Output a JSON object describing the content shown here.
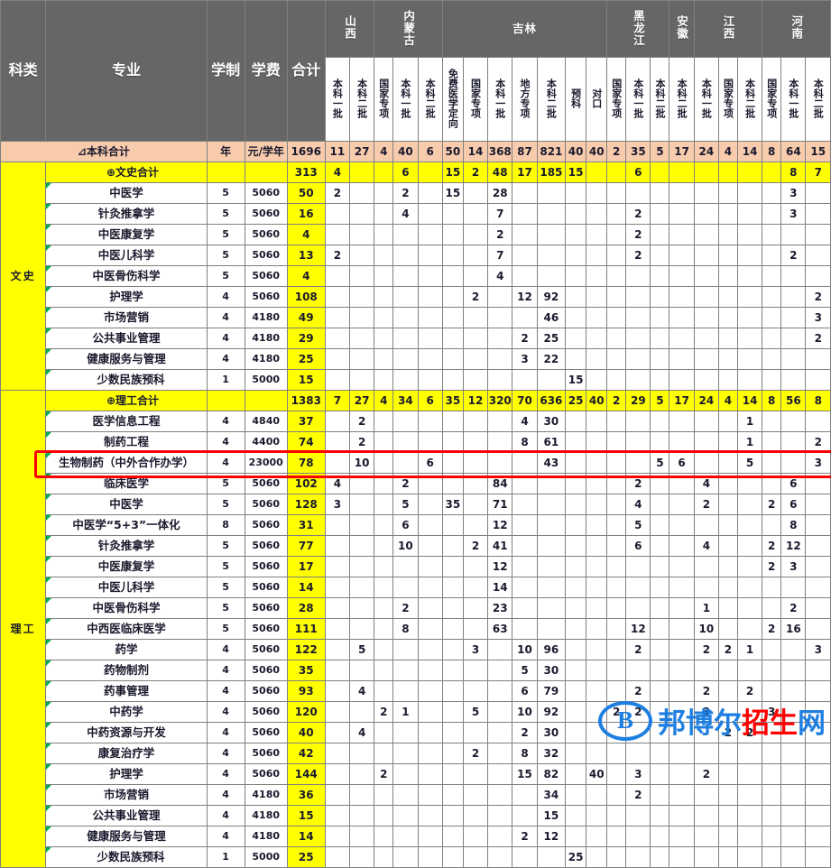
{
  "header": {
    "fixed_columns": [
      {
        "label": "科类",
        "key": "category"
      },
      {
        "label": "专业",
        "key": "major"
      },
      {
        "label": "学制",
        "key": "years"
      },
      {
        "label": "学费",
        "key": "fee"
      },
      {
        "label": "合计",
        "key": "total"
      }
    ],
    "provinces": [
      {
        "name": "山西",
        "cols": [
          "本科一批",
          "本科二批"
        ]
      },
      {
        "name": "内蒙古",
        "cols": [
          "国家专项",
          "本科一批",
          "本科二批"
        ]
      },
      {
        "name": "吉林",
        "cols": [
          "免费医学定向",
          "国家专项",
          "本科一批",
          "地方专项",
          "本科二批",
          "预科",
          "对口"
        ]
      },
      {
        "name": "黑龙江",
        "cols": [
          "国家专项",
          "本科一批",
          "本科二批"
        ]
      },
      {
        "name": "安徽",
        "cols": [
          "本科二批"
        ]
      },
      {
        "name": "江西",
        "cols": [
          "本科一批",
          "国家专项",
          "本科二批"
        ]
      },
      {
        "name": "河南",
        "cols": [
          "国家专项",
          "本科一批",
          "本科二批"
        ]
      }
    ]
  },
  "grand_total": {
    "label": "⊿本科合计",
    "years": "年",
    "fee": "元/学年",
    "total": "1696",
    "values": [
      "11",
      "27",
      "4",
      "40",
      "6",
      "50",
      "14",
      "368",
      "87",
      "821",
      "40",
      "40",
      "2",
      "35",
      "5",
      "17",
      "24",
      "4",
      "14",
      "8",
      "64",
      "15"
    ]
  },
  "sections": [
    {
      "category": "文史",
      "group": {
        "label": "⊕文史合计",
        "years": "",
        "fee": "",
        "total": "313",
        "values": [
          "4",
          "",
          "",
          "6",
          "",
          "15",
          "2",
          "48",
          "17",
          "185",
          "15",
          "",
          "",
          "6",
          "",
          "",
          "",
          "",
          "",
          "",
          "8",
          "7"
        ]
      },
      "rows": [
        {
          "major": "中医学",
          "years": "5",
          "fee": "5060",
          "total": "50",
          "values": [
            "2",
            "",
            "",
            "2",
            "",
            "15",
            "",
            "28",
            "",
            "",
            "",
            "",
            "",
            "",
            "",
            "",
            "",
            "",
            "",
            "",
            "3",
            ""
          ]
        },
        {
          "major": "针灸推拿学",
          "years": "5",
          "fee": "5060",
          "total": "16",
          "values": [
            "",
            "",
            "",
            "4",
            "",
            "",
            "",
            "7",
            "",
            "",
            "",
            "",
            "",
            "2",
            "",
            "",
            "",
            "",
            "",
            "",
            "3",
            ""
          ]
        },
        {
          "major": "中医康复学",
          "years": "5",
          "fee": "5060",
          "total": "4",
          "values": [
            "",
            "",
            "",
            "",
            "",
            "",
            "",
            "2",
            "",
            "",
            "",
            "",
            "",
            "2",
            "",
            "",
            "",
            "",
            "",
            "",
            "",
            ""
          ]
        },
        {
          "major": "中医儿科学",
          "years": "5",
          "fee": "5060",
          "total": "13",
          "values": [
            "2",
            "",
            "",
            "",
            "",
            "",
            "",
            "7",
            "",
            "",
            "",
            "",
            "",
            "2",
            "",
            "",
            "",
            "",
            "",
            "",
            "2",
            ""
          ]
        },
        {
          "major": "中医骨伤科学",
          "years": "5",
          "fee": "5060",
          "total": "4",
          "values": [
            "",
            "",
            "",
            "",
            "",
            "",
            "",
            "4",
            "",
            "",
            "",
            "",
            "",
            "",
            "",
            "",
            "",
            "",
            "",
            "",
            "",
            ""
          ]
        },
        {
          "major": "护理学",
          "years": "4",
          "fee": "5060",
          "total": "108",
          "values": [
            "",
            "",
            "",
            "",
            "",
            "",
            "2",
            "",
            "12",
            "92",
            "",
            "",
            "",
            "",
            "",
            "",
            "",
            "",
            "",
            "",
            "",
            "2"
          ]
        },
        {
          "major": "市场营销",
          "years": "4",
          "fee": "4180",
          "total": "49",
          "values": [
            "",
            "",
            "",
            "",
            "",
            "",
            "",
            "",
            "",
            "46",
            "",
            "",
            "",
            "",
            "",
            "",
            "",
            "",
            "",
            "",
            "",
            "3"
          ]
        },
        {
          "major": "公共事业管理",
          "years": "4",
          "fee": "4180",
          "total": "29",
          "values": [
            "",
            "",
            "",
            "",
            "",
            "",
            "",
            "",
            "2",
            "25",
            "",
            "",
            "",
            "",
            "",
            "",
            "",
            "",
            "",
            "",
            "",
            "2"
          ]
        },
        {
          "major": "健康服务与管理",
          "years": "4",
          "fee": "4180",
          "total": "25",
          "values": [
            "",
            "",
            "",
            "",
            "",
            "",
            "",
            "",
            "3",
            "22",
            "",
            "",
            "",
            "",
            "",
            "",
            "",
            "",
            "",
            "",
            "",
            ""
          ]
        },
        {
          "major": "少数民族预科",
          "nopad": true,
          "years": "1",
          "fee": "5000",
          "total": "15",
          "values": [
            "",
            "",
            "",
            "",
            "",
            "",
            "",
            "",
            "",
            "",
            "15",
            "",
            "",
            "",
            "",
            "",
            "",
            "",
            "",
            "",
            "",
            ""
          ]
        }
      ]
    },
    {
      "category": "理工",
      "group": {
        "label": "⊕理工合计",
        "years": "",
        "fee": "",
        "total": "1383",
        "values": [
          "7",
          "27",
          "4",
          "34",
          "6",
          "35",
          "12",
          "320",
          "70",
          "636",
          "25",
          "40",
          "2",
          "29",
          "5",
          "17",
          "24",
          "4",
          "14",
          "8",
          "56",
          "8"
        ]
      },
      "rows": [
        {
          "major": "医学信息工程",
          "years": "4",
          "fee": "4840",
          "total": "37",
          "values": [
            "",
            "2",
            "",
            "",
            "",
            "",
            "",
            "",
            "4",
            "30",
            "",
            "",
            "",
            "",
            "",
            "",
            "",
            "",
            "1",
            "",
            "",
            ""
          ]
        },
        {
          "major": "制药工程",
          "years": "4",
          "fee": "4400",
          "total": "74",
          "values": [
            "",
            "2",
            "",
            "",
            "",
            "",
            "",
            "",
            "8",
            "61",
            "",
            "",
            "",
            "",
            "",
            "",
            "",
            "",
            "1",
            "",
            "",
            "2"
          ]
        },
        {
          "major": "生物制药（中外合作办学）",
          "highlight": true,
          "years": "4",
          "fee": "23000",
          "total": "78",
          "values": [
            "",
            "10",
            "",
            "",
            "6",
            "",
            "",
            "",
            "",
            "43",
            "",
            "",
            "",
            "",
            "5",
            "6",
            "",
            "",
            "5",
            "",
            "",
            "3"
          ]
        },
        {
          "major": "临床医学",
          "years": "5",
          "fee": "5060",
          "total": "102",
          "values": [
            "4",
            "",
            "",
            "2",
            "",
            "",
            "",
            "84",
            "",
            "",
            "",
            "",
            "",
            "2",
            "",
            "",
            "4",
            "",
            "",
            "",
            "6",
            ""
          ]
        },
        {
          "major": "中医学",
          "years": "5",
          "fee": "5060",
          "total": "128",
          "values": [
            "3",
            "",
            "",
            "5",
            "",
            "35",
            "",
            "71",
            "",
            "",
            "",
            "",
            "",
            "4",
            "",
            "",
            "2",
            "",
            "",
            "2",
            "6",
            ""
          ]
        },
        {
          "major": "中医学“5+3”一体化",
          "years": "8",
          "fee": "5060",
          "total": "31",
          "values": [
            "",
            "",
            "",
            "6",
            "",
            "",
            "",
            "12",
            "",
            "",
            "",
            "",
            "",
            "5",
            "",
            "",
            "",
            "",
            "",
            "",
            "8",
            ""
          ]
        },
        {
          "major": "针灸推拿学",
          "years": "5",
          "fee": "5060",
          "total": "77",
          "values": [
            "",
            "",
            "",
            "10",
            "",
            "",
            "2",
            "41",
            "",
            "",
            "",
            "",
            "",
            "6",
            "",
            "",
            "4",
            "",
            "",
            "2",
            "12",
            ""
          ]
        },
        {
          "major": "中医康复学",
          "years": "5",
          "fee": "5060",
          "total": "17",
          "values": [
            "",
            "",
            "",
            "",
            "",
            "",
            "",
            "12",
            "",
            "",
            "",
            "",
            "",
            "",
            "",
            "",
            "",
            "",
            "",
            "2",
            "3",
            ""
          ]
        },
        {
          "major": "中医儿科学",
          "years": "5",
          "fee": "5060",
          "total": "14",
          "values": [
            "",
            "",
            "",
            "",
            "",
            "",
            "",
            "14",
            "",
            "",
            "",
            "",
            "",
            "",
            "",
            "",
            "",
            "",
            "",
            "",
            "",
            ""
          ]
        },
        {
          "major": "中医骨伤科学",
          "years": "5",
          "fee": "5060",
          "total": "28",
          "values": [
            "",
            "",
            "",
            "2",
            "",
            "",
            "",
            "23",
            "",
            "",
            "",
            "",
            "",
            "",
            "",
            "",
            "1",
            "",
            "",
            "",
            "2",
            ""
          ]
        },
        {
          "major": "中西医临床医学",
          "years": "5",
          "fee": "5060",
          "total": "111",
          "values": [
            "",
            "",
            "",
            "8",
            "",
            "",
            "",
            "63",
            "",
            "",
            "",
            "",
            "",
            "12",
            "",
            "",
            "10",
            "",
            "",
            "2",
            "16",
            ""
          ]
        },
        {
          "major": "药学",
          "years": "4",
          "fee": "5060",
          "total": "122",
          "values": [
            "",
            "5",
            "",
            "",
            "",
            "",
            "3",
            "",
            "10",
            "96",
            "",
            "",
            "",
            "2",
            "",
            "",
            "2",
            "2",
            "1",
            "",
            "",
            "3"
          ]
        },
        {
          "major": "药物制剂",
          "years": "4",
          "fee": "5060",
          "total": "35",
          "values": [
            "",
            "",
            "",
            "",
            "",
            "",
            "",
            "",
            "5",
            "30",
            "",
            "",
            "",
            "",
            "",
            "",
            "",
            "",
            "",
            "",
            "",
            ""
          ]
        },
        {
          "major": "药事管理",
          "years": "4",
          "fee": "5060",
          "total": "93",
          "values": [
            "",
            "4",
            "",
            "",
            "",
            "",
            "",
            "",
            "6",
            "79",
            "",
            "",
            "",
            "2",
            "",
            "",
            "2",
            "",
            "2",
            "",
            "",
            ""
          ]
        },
        {
          "major": "中药学",
          "years": "4",
          "fee": "5060",
          "total": "120",
          "values": [
            "",
            "",
            "2",
            "1",
            "",
            "",
            "5",
            "",
            "10",
            "92",
            "",
            "",
            "2",
            "2",
            "",
            "",
            "3",
            "",
            "",
            "3",
            "",
            ""
          ]
        },
        {
          "major": "中药资源与开发",
          "years": "4",
          "fee": "5060",
          "total": "40",
          "values": [
            "",
            "4",
            "",
            "",
            "",
            "",
            "",
            "",
            "2",
            "30",
            "",
            "",
            "",
            "",
            "",
            "",
            "",
            "2",
            "2",
            "",
            "",
            ""
          ]
        },
        {
          "major": "康复治疗学",
          "years": "4",
          "fee": "5060",
          "total": "42",
          "values": [
            "",
            "",
            "",
            "",
            "",
            "",
            "2",
            "",
            "8",
            "32",
            "",
            "",
            "",
            "",
            "",
            "",
            "",
            "",
            "",
            "",
            "",
            ""
          ]
        },
        {
          "major": "护理学",
          "years": "4",
          "fee": "5060",
          "total": "144",
          "values": [
            "",
            "",
            "2",
            "",
            "",
            "",
            "",
            "",
            "15",
            "82",
            "",
            "40",
            "",
            "3",
            "",
            "",
            "2",
            "",
            "",
            "",
            "",
            ""
          ]
        },
        {
          "major": "市场营销",
          "years": "4",
          "fee": "4180",
          "total": "36",
          "values": [
            "",
            "",
            "",
            "",
            "",
            "",
            "",
            "",
            "",
            "34",
            "",
            "",
            "",
            "2",
            "",
            "",
            "",
            "",
            "",
            "",
            "",
            ""
          ]
        },
        {
          "major": "公共事业管理",
          "years": "4",
          "fee": "4180",
          "total": "15",
          "values": [
            "",
            "",
            "",
            "",
            "",
            "",
            "",
            "",
            "",
            "15",
            "",
            "",
            "",
            "",
            "",
            "",
            "",
            "",
            "",
            "",
            "",
            ""
          ]
        },
        {
          "major": "健康服务与管理",
          "years": "4",
          "fee": "4180",
          "total": "14",
          "values": [
            "",
            "",
            "",
            "",
            "",
            "",
            "",
            "",
            "2",
            "12",
            "",
            "",
            "",
            "",
            "",
            "",
            "",
            "",
            "",
            "",
            "",
            ""
          ]
        },
        {
          "major": "少数民族预科",
          "nopad": true,
          "years": "1",
          "fee": "5000",
          "total": "25",
          "values": [
            "",
            "",
            "",
            "",
            "",
            "",
            "",
            "",
            "",
            "",
            "25",
            "",
            "",
            "",
            "",
            "",
            "",
            "",
            "",
            "",
            "",
            ""
          ]
        }
      ]
    }
  ],
  "watermark": {
    "mark": "B",
    "text_blue_1": "邦博尔",
    "text_red": "招生",
    "text_blue_2": "网"
  },
  "colors": {
    "header_gray": "#666666",
    "total_peach": "#f8cbad",
    "group_yellow": "#ffff00",
    "cat_wen_green": "#e2efda",
    "cat_li_blue": "#dce6f1",
    "highlight_red": "#ff0000",
    "marker_green": "#00b050"
  }
}
